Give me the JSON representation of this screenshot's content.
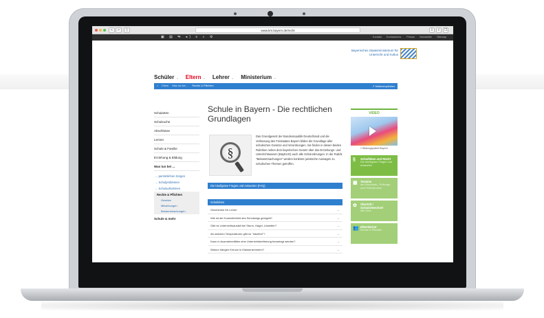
{
  "browser": {
    "url": "www.km.bayern.de/recht",
    "back": "<",
    "forward": ">"
  },
  "topbar": {
    "icons": "▣ ▤ ⇆ ◂) ≡ ⌕ ⚙",
    "links": [
      "Kontakt",
      "Kontrastvers.",
      "Presse",
      "Newsletter",
      "Sitemap"
    ]
  },
  "ministry": {
    "line1": "Bayerisches Staatsministerium für",
    "line2": "Unterricht und Kultus"
  },
  "nav": {
    "items": [
      {
        "label": "Schüler",
        "active": false
      },
      {
        "label": "Eltern",
        "active": true
      },
      {
        "label": "Lehrer",
        "active": false
      },
      {
        "label": "Ministerium",
        "active": false
      }
    ],
    "chevron": "⌄"
  },
  "breadcrumb": {
    "home": "⌂",
    "items": [
      "Eltern",
      "Was tun bei ...",
      "Rechte & Pflichten"
    ],
    "right": "↗ Seitenempfehlen"
  },
  "sidebar": {
    "items": [
      "Schularten",
      "Schulsuche",
      "Abschlüsse",
      "Lernen",
      "Schule & Familie",
      "Erziehung & Bildung",
      "Was tun bei ..."
    ],
    "sub": [
      "... persönlichen Sorgen",
      "... Schulproblemen",
      "... Schulaufnahmen"
    ],
    "active": "Rechte & Pflichten",
    "sub2": [
      "Gesetze",
      "Mitwirkungen",
      "Bekanntmachungen"
    ],
    "last": "Schule & mehr"
  },
  "main": {
    "title": "Schule in Bayern - Die rechtlichen Grundlagen",
    "para_symbol": "§",
    "intro": "Das Grundgesetz der Bundesrepublik Deutschland und die Verfassung des Freistaates Bayern bilden die Grundlage aller schulischen Gesetze und Verordnungen. Sie finden in diesen beiden Rubriken neben dem bayerischen Gesetz über das Erziehungs- und Unterrichtswesen (BayEUG) auch alle Schulordnungen. In der Rubrik \"Bekanntmachungen\" werden konkrete juristische Aussagen zu schulischen Themen getroffen.",
    "faq_bar": "Die häufigsten Fragen und Antworten (FAQ)",
    "school_bar": "Schulleben",
    "questions": [
      "Geschenke für Lehrer",
      "Wie ist die Kostenfreiheit des Schulwegs geregelt?",
      "Gibt es Unterrichtsausfall bei Sturm, Hagel, Unwetter?",
      "Ab welchen Temperaturen gibt es \"hitzefrei\"?",
      "Kann in Ausnahmefällen eine Unterrichtsbefreiung beantragt werden?",
      "Warum hängen Kreuze in Klassenzimmern?"
    ],
    "chev": "⌄"
  },
  "rightcol": {
    "video_head": "VIDEO",
    "video_caption": "» Bildungspaket Bayern",
    "tiles": [
      {
        "icon": "§",
        "t1": "Schulleben und Recht",
        "t2": "Die wichtigsten Fragen und Antworten"
      },
      {
        "icon": "▦",
        "t1": "Termine",
        "t2": "der Einschreib-, Prüfungs- und Ferientermine"
      },
      {
        "icon": "✿",
        "t1": "Übertritt / Schulartwechsel",
        "t2": "Alle Infos"
      },
      {
        "icon": "👥",
        "t1": "Elternbeirat",
        "t2": "Rechte & Pflichten"
      }
    ]
  }
}
